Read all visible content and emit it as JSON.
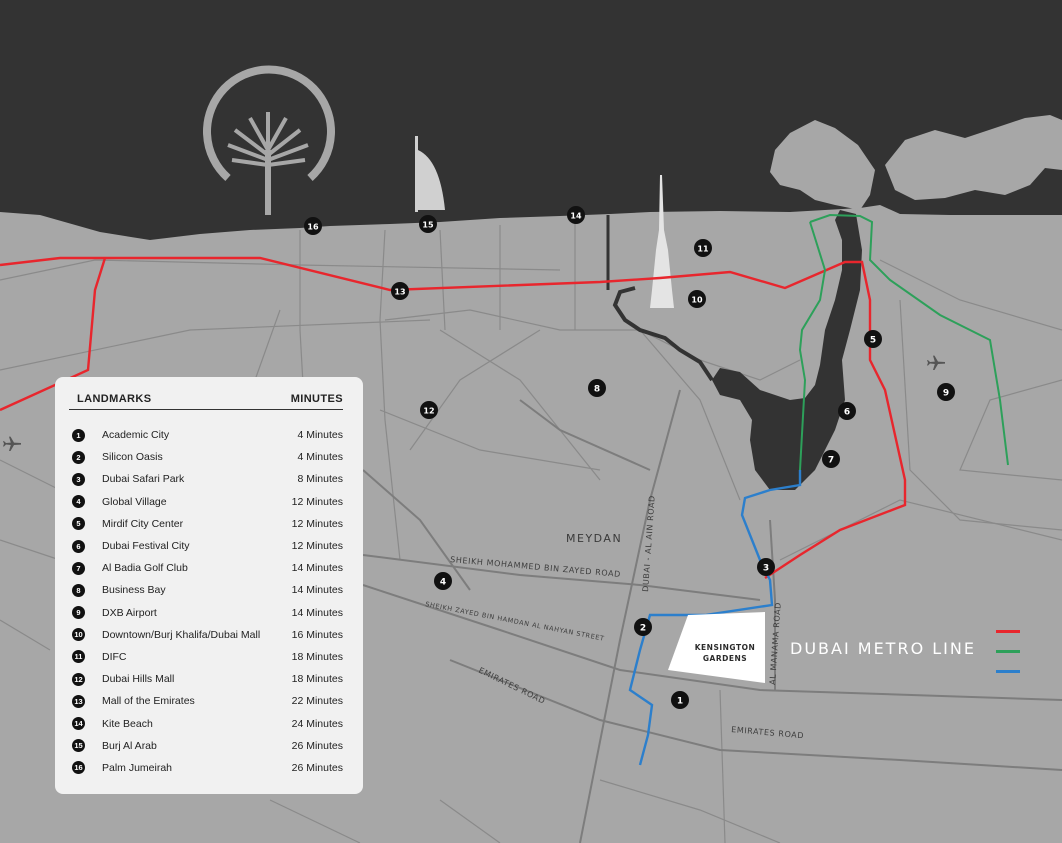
{
  "legend": {
    "header_left": "LANDMARKS",
    "header_right": "MINUTES",
    "items": [
      {
        "num": "1",
        "name": "Academic City",
        "minutes": "4 Minutes"
      },
      {
        "num": "2",
        "name": "Silicon Oasis",
        "minutes": "4 Minutes"
      },
      {
        "num": "3",
        "name": "Dubai Safari Park",
        "minutes": "8 Minutes"
      },
      {
        "num": "4",
        "name": "Global Village",
        "minutes": "12 Minutes"
      },
      {
        "num": "5",
        "name": "Mirdif City Center",
        "minutes": "12 Minutes"
      },
      {
        "num": "6",
        "name": "Dubai Festival City",
        "minutes": "12 Minutes"
      },
      {
        "num": "7",
        "name": "Al Badia Golf Club",
        "minutes": "14 Minutes"
      },
      {
        "num": "8",
        "name": "Business Bay",
        "minutes": "14 Minutes"
      },
      {
        "num": "9",
        "name": "DXB Airport",
        "minutes": "14 Minutes"
      },
      {
        "num": "10",
        "name": "Downtown/Burj Khalifa/Dubai Mall",
        "minutes": "16 Minutes"
      },
      {
        "num": "11",
        "name": "DIFC",
        "minutes": "18 Minutes"
      },
      {
        "num": "12",
        "name": "Dubai Hills Mall",
        "minutes": "18 Minutes"
      },
      {
        "num": "13",
        "name": "Mall of the Emirates",
        "minutes": "22 Minutes"
      },
      {
        "num": "14",
        "name": "Kite Beach",
        "minutes": "24 Minutes"
      },
      {
        "num": "15",
        "name": "Burj Al Arab",
        "minutes": "26 Minutes"
      },
      {
        "num": "16",
        "name": "Palm Jumeirah",
        "minutes": "26 Minutes"
      }
    ]
  },
  "map": {
    "area_label": "MEYDAN",
    "development_label_line1": "KENSINGTON",
    "development_label_line2": "GARDENS",
    "metro_label": "DUBAI METRO LINE",
    "roads": {
      "sheikh_mohammed": "SHEIKH MOHAMMED BIN ZAYED ROAD",
      "sheikh_zayed": "SHEIKH ZAYED BIN HAMDAN AL NAHYAN STREET",
      "al_ain": "DUBAI - AL AIN ROAD",
      "al_manama": "AL MANAMA ROAD",
      "emirates_1": "EMIRATES ROAD",
      "emirates_2": "EMIRATES ROAD"
    },
    "pins": {
      "p1": "1",
      "p2": "2",
      "p3": "3",
      "p4": "4",
      "p5": "5",
      "p6": "6",
      "p7": "7",
      "p8": "8",
      "p9": "9",
      "p10": "10",
      "p11": "11",
      "p12": "12",
      "p13": "13",
      "p14": "14",
      "p15": "15",
      "p16": "16"
    },
    "icons": [
      "airport-icon",
      "airport-icon"
    ]
  },
  "metro_lines": [
    {
      "color": "#e8262d"
    },
    {
      "color": "#2da05a"
    },
    {
      "color": "#2c7fcc"
    }
  ],
  "colors": {
    "sea": "#333333",
    "land": "#a7a7a7",
    "roads": "#8a8a8a",
    "pin": "#111111",
    "development": "#ffffff"
  }
}
